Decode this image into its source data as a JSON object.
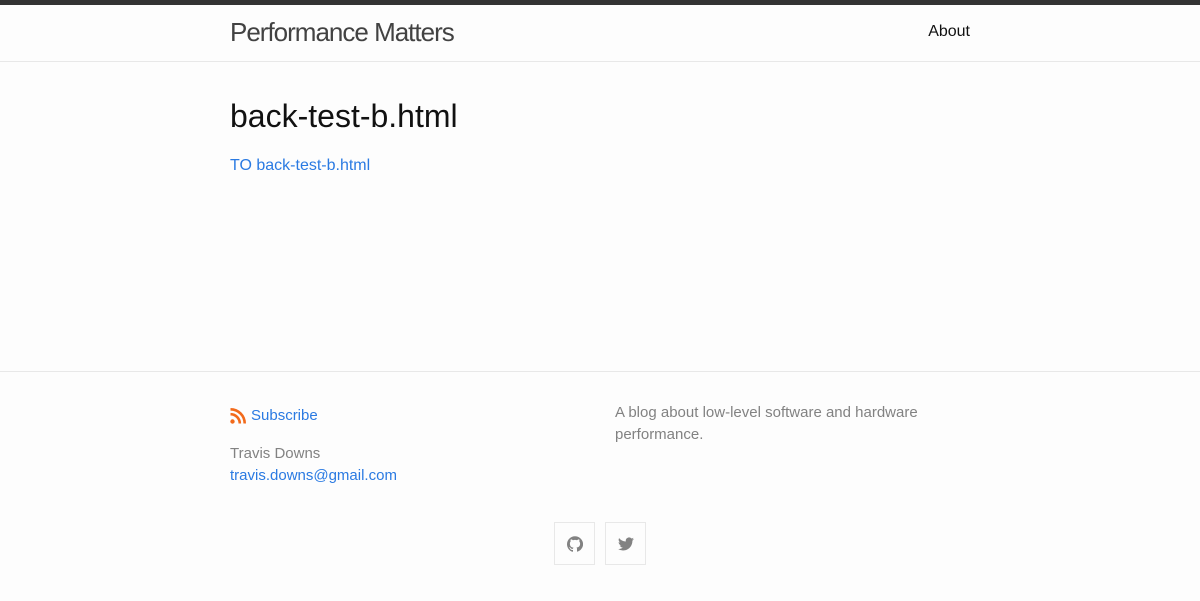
{
  "header": {
    "site_title": "Performance Matters",
    "nav": {
      "about": "About"
    }
  },
  "main": {
    "post_title": "back-test-b.html",
    "redirect_link": "TO back-test-b.html"
  },
  "footer": {
    "subscribe_label": "Subscribe",
    "author_name": "Travis Downs",
    "author_email": "travis.downs@gmail.com",
    "description": "A blog about low-level software and hardware performance.",
    "social": [
      {
        "icon": "github-icon"
      },
      {
        "icon": "twitter-icon"
      }
    ]
  },
  "colors": {
    "link": "#2a7ae2",
    "rss": "#f26a1b",
    "top_bar": "#333333",
    "muted_text": "#828282"
  }
}
